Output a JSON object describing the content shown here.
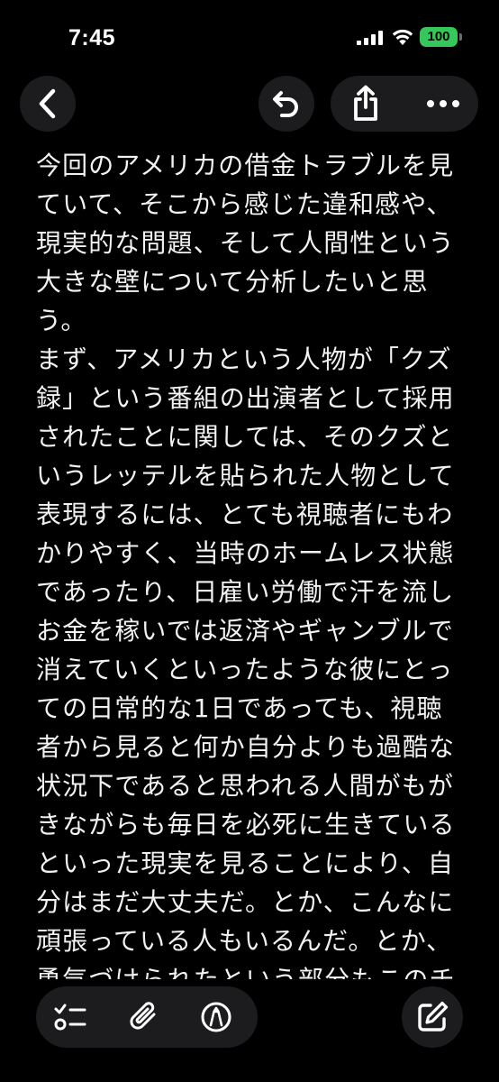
{
  "status_bar": {
    "time": "7:45",
    "battery_level": "100",
    "signal_icon": "cellular-signal-icon",
    "wifi_icon": "wifi-icon"
  },
  "nav": {
    "back_icon": "chevron-left-icon",
    "undo_icon": "undo-arrow-icon",
    "share_icon": "share-icon",
    "more_icon": "ellipsis-icon"
  },
  "note": {
    "paragraphs": [
      "今回のアメリカの借金トラブルを見ていて、そこから感じた違和感や、現実的な問題、そして人間性という大きな壁について分析したいと思う。",
      "まず、アメリカという人物が「クズ録」という番組の出演者として採用されたことに関しては、そのクズというレッテルを貼られた人物として表現するには、とても視聴者にもわかりやすく、当時のホームレス状態であったり、日雇い労働で汗を流しお金を稼いでは返済やギャンブルで消えていくといったような彼にとっての日常的な1日であっても、視聴者から見ると何か自分よりも過酷な状況下であると思われる人間がもがきながらも毎日を必死に生きているといった現実を見ることにより、自分はまだ大丈夫だ。とか、こんなに頑張っている人もいるんだ。とか、勇気づけられたという部分もこのチャンネルが有名になるそのきっかけになったというのも非常によくわか"
    ]
  },
  "toolbar": {
    "checklist_icon": "checklist-icon",
    "attach_icon": "paperclip-icon",
    "markup_icon": "markup-pen-icon",
    "compose_icon": "compose-icon"
  },
  "colors": {
    "background": "#000000",
    "button_bg": "#1c1c1e",
    "text": "#f2f2f2",
    "battery": "#35c759"
  }
}
